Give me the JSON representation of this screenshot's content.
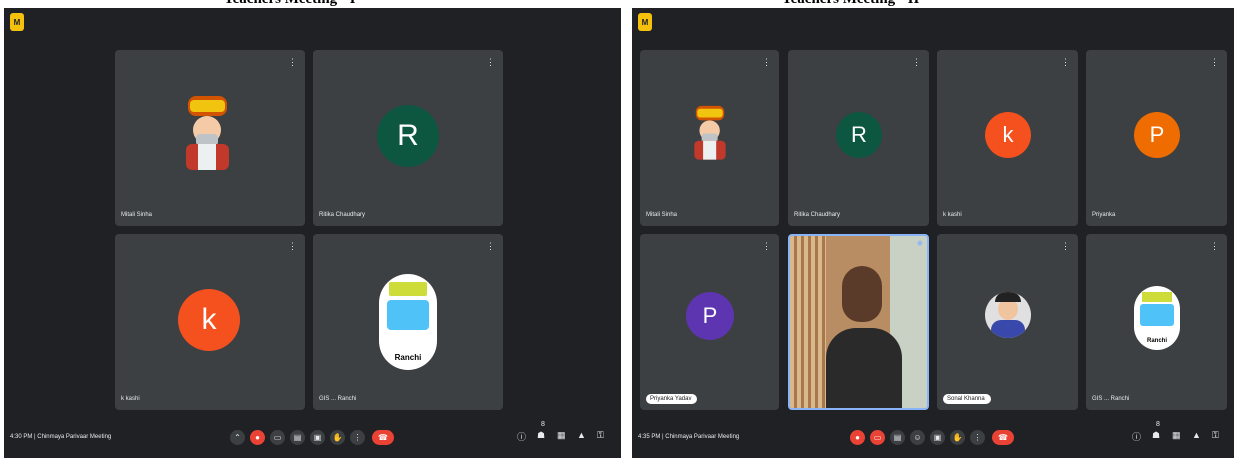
{
  "colors": {
    "bg": "#202124",
    "tile": "#3c4043",
    "end": "#ea4335",
    "text": "#e8eaed"
  },
  "captions": {
    "left": "Teachers Meeting - I",
    "right": "Teachers Meeting - II"
  },
  "left": {
    "tiles": [
      {
        "name": "Mitali Sinha",
        "avatar": "illustration"
      },
      {
        "name": "Ritika Chaudhary",
        "initial": "R"
      },
      {
        "name": "k kashi",
        "initial": "k"
      },
      {
        "name": "GIS ... Ranchi",
        "avatar": "logo"
      }
    ],
    "meeting": "4:30 PM | Chinmaya Parivaar Meeting",
    "more_label": "⋮"
  },
  "right": {
    "tiles": [
      {
        "name": "Mitali Sinha",
        "avatar": "illustration"
      },
      {
        "name": "Ritika Chaudhary",
        "initial": "R"
      },
      {
        "name": "k kashi",
        "initial": "k"
      },
      {
        "name": "Priyanka",
        "initial": "P"
      },
      {
        "name": "Priyanka Yadav",
        "initial": "P"
      },
      {
        "name": "",
        "avatar": "video"
      },
      {
        "name": "Sonal Khanna",
        "avatar": "photo"
      },
      {
        "name": "GIS ... Ranchi",
        "avatar": "logo"
      }
    ],
    "meeting": "4:35 PM | Chinmaya Parivaar Meeting"
  },
  "logo_label": "M",
  "ranchi_label": "Ranchi",
  "icons": [
    "mic-icon",
    "camera-icon",
    "captions-icon",
    "emoji-icon",
    "present-icon",
    "raise-hand-icon",
    "more-options-icon",
    "end-call-icon",
    "info-icon",
    "people-icon",
    "chat-icon",
    "activities-icon",
    "host-controls-icon"
  ],
  "people_count": "8"
}
